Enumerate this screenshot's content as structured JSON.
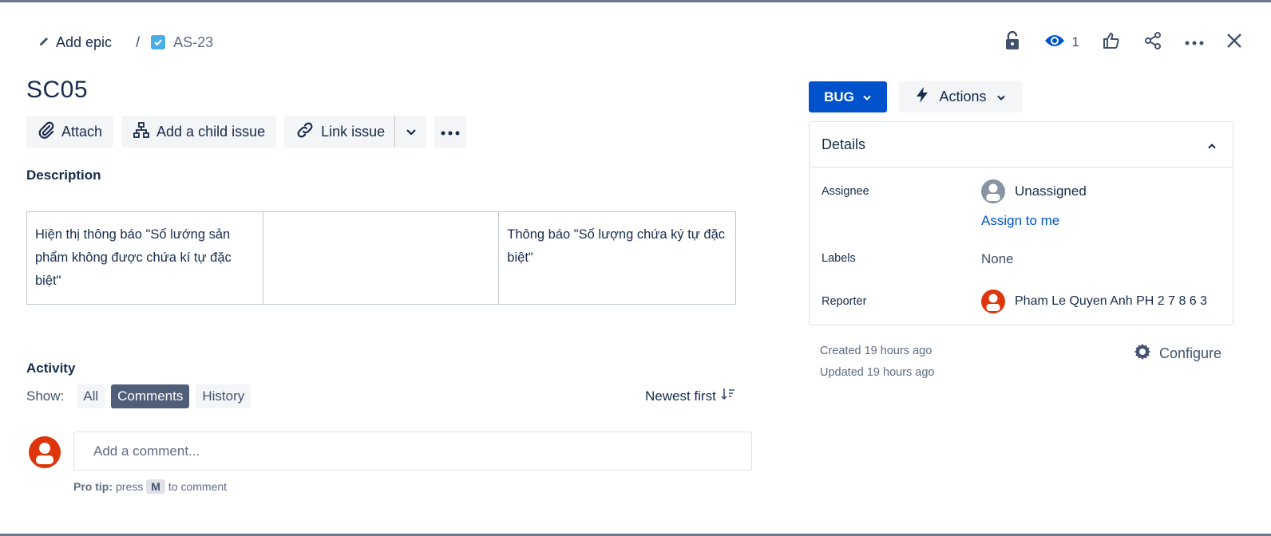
{
  "breadcrumb": {
    "epic_label": "Add epic",
    "separator": "/",
    "issue_key": "AS-23"
  },
  "top_actions": {
    "watch_count": "1"
  },
  "issue": {
    "title": "SC05"
  },
  "toolbar": {
    "attach": "Attach",
    "add_child": "Add a child issue",
    "link_issue": "Link issue"
  },
  "description": {
    "label": "Description",
    "table": [
      [
        "Hiện thị thông báo \"Số lướng sản phẩm không được chứa kí tự đặc biệt\"",
        "",
        "Thông báo \"Số lượng chứa ký tự đặc biệt\""
      ]
    ]
  },
  "activity": {
    "label": "Activity",
    "show_label": "Show:",
    "filters": [
      "All",
      "Comments",
      "History"
    ],
    "active_filter": "Comments",
    "sort_label": "Newest first",
    "comment_placeholder": "Add a comment...",
    "protip_bold": "Pro tip:",
    "protip_pre": "press",
    "protip_key": "M",
    "protip_post": "to comment"
  },
  "status": {
    "label": "BUG",
    "color": "#0052cc"
  },
  "actions_label": "Actions",
  "details": {
    "heading": "Details",
    "assignee_label": "Assignee",
    "assignee_value": "Unassigned",
    "assign_to_me": "Assign to me",
    "labels_label": "Labels",
    "labels_value": "None",
    "reporter_label": "Reporter",
    "reporter_value": "Pham Le Quyen Anh PH 2 7 8 6 3"
  },
  "meta": {
    "created": "Created 19 hours ago",
    "updated": "Updated 19 hours ago",
    "configure": "Configure"
  }
}
